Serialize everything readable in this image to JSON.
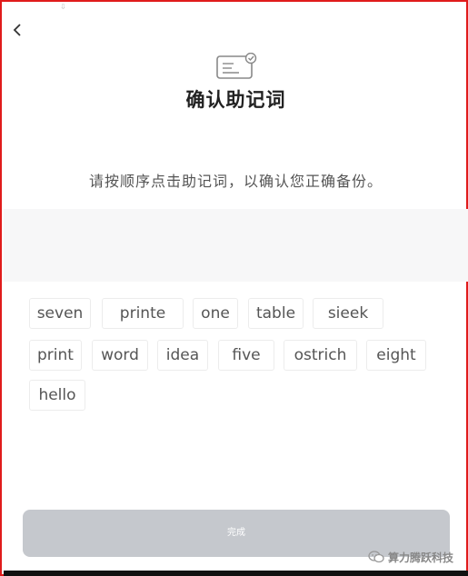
{
  "header": {
    "back_icon": "chevron-left-icon",
    "page_icon": "card-check-icon",
    "title": "确认助记词"
  },
  "instructions": "请按顺序点击助记词，以确认您正确备份。",
  "words": [
    "seven",
    "printe",
    "one",
    "table",
    "sieek",
    "print",
    "word",
    "idea",
    "five",
    "ostrich",
    "eight",
    "hello"
  ],
  "done_button": {
    "label": "完成"
  },
  "watermark": {
    "text": "算力腾跃科技",
    "icon": "wechat-icon"
  },
  "colors": {
    "frame_border": "#e01b1b",
    "button_disabled": "#c5c8cd"
  }
}
